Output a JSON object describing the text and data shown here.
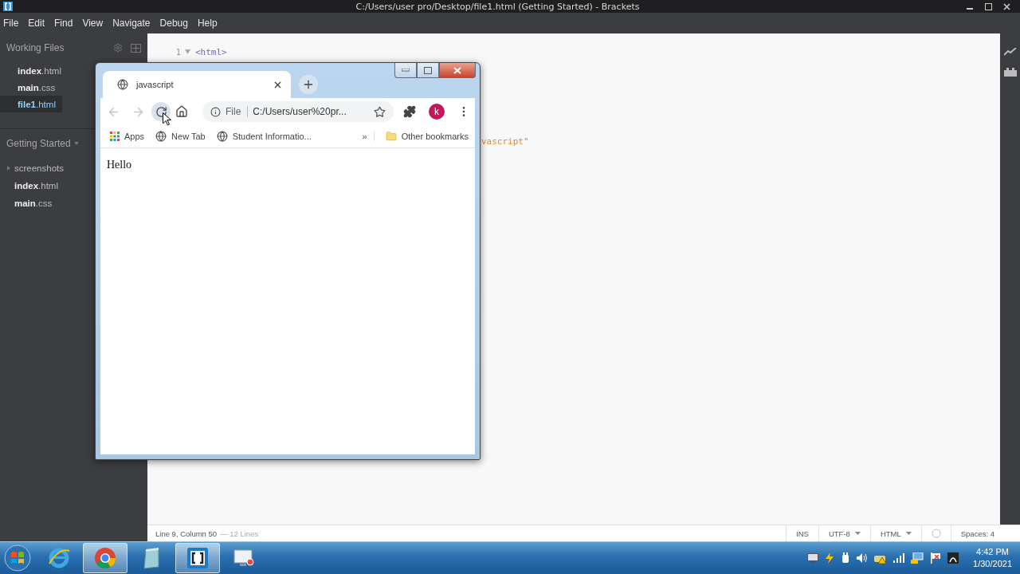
{
  "window": {
    "title": "C:/Users/user pro/Desktop/file1.html (Getting Started) - Brackets"
  },
  "menu": [
    "File",
    "Edit",
    "Find",
    "View",
    "Navigate",
    "Debug",
    "Help"
  ],
  "sidebar": {
    "working_files": {
      "title": "Working Files",
      "items": [
        {
          "name": "**index**.html",
          "selected": false
        },
        {
          "name": "**main**.css",
          "selected": false
        },
        {
          "name": "**file1**.html",
          "selected": true
        }
      ]
    },
    "project": {
      "title": "Getting Started",
      "tree": [
        {
          "name": "screenshots",
          "kind": "folder",
          "expanded": false
        },
        {
          "name": "**index**.html",
          "kind": "file"
        },
        {
          "name": "**main**.css",
          "kind": "file"
        }
      ]
    }
  },
  "editor": {
    "lines": [
      {
        "kind": "line",
        "number": "1",
        "fold": true,
        "code": "<html>"
      },
      {
        "kind": "fragment",
        "code": "vascript\""
      }
    ]
  },
  "status_bar": {
    "cursor": "Line 9, Column 50",
    "lines": "— 12 Lines",
    "mode": "INS",
    "encoding": "UTF-8",
    "language": "HTML",
    "indent": "Spaces: 4"
  },
  "browser": {
    "tab": {
      "title": "javascript"
    },
    "back": {
      "disabled": true
    },
    "forward": {
      "disabled": true
    },
    "omnibox": {
      "scheme": "File",
      "url": "C:/Users/user%20pr..."
    },
    "profile": "k",
    "bookmarks": [
      {
        "label": "Apps",
        "kind": "apps"
      },
      {
        "label": "New Tab",
        "kind": "page"
      },
      {
        "label": "Student Informatio...",
        "kind": "page"
      }
    ],
    "overflow": "»",
    "other_bookmarks": "Other bookmarks",
    "page": {
      "text": "Hello"
    }
  },
  "taskbar": {
    "apps": [
      {
        "kind": "ie",
        "active": false
      },
      {
        "kind": "chrome",
        "active": true
      },
      {
        "kind": "notepad",
        "active": false
      },
      {
        "kind": "brackets",
        "active": true
      },
      {
        "kind": "recorder",
        "active": false
      }
    ],
    "time": "4:42 PM",
    "date": "1/30/2021"
  }
}
